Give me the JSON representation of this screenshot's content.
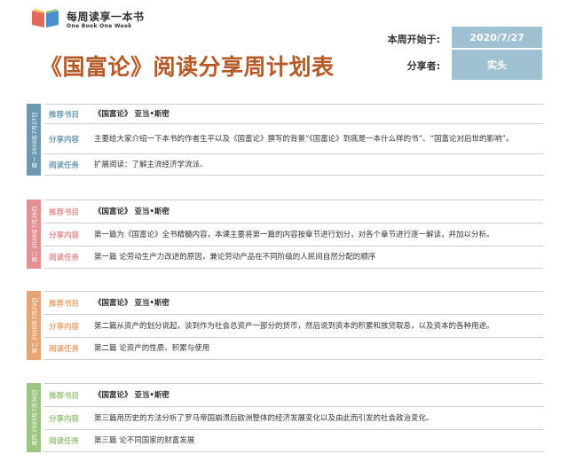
{
  "logo": {
    "cn": "每周读享一本书",
    "en": "One Book One Week"
  },
  "title": "《国富论》阅读分享周计划表",
  "header": {
    "start_label": "本周开始于:",
    "start_value": "2020/7/27",
    "sharer_label": "分享者:",
    "sharer_value": "实头"
  },
  "colors": {
    "blue": "#6b9ab0",
    "pink": "#e58f93",
    "orange": "#e8a472",
    "green": "#9cc57f"
  },
  "days": [
    {
      "tab": "周一 2020年7月27日",
      "color": "#6b9ab0",
      "rows": [
        {
          "label": "推荐书目",
          "text": "《国富论》 亚当•斯密"
        },
        {
          "label": "分享内容",
          "text": "主要给大家介绍一下本书的作者生平以及《国富论》撰写的背景”《国富论》到底是一本什么样的书”、“国富论对后世的影响”。"
        },
        {
          "label": "阅读任务",
          "text": "扩展阅读：了解主流经济学流派、"
        }
      ]
    },
    {
      "tab": "周二 2020年7月28日",
      "color": "#e58f93",
      "rows": [
        {
          "label": "推荐书目",
          "text": "《国富论》 亚当•斯密"
        },
        {
          "label": "分享内容",
          "text": "第一篇为《国富论》全书精髓内容，本课主要将第一篇的内容按章节进行划分，对各个章节进行逐一解读，并加以分析。"
        },
        {
          "label": "阅读任务",
          "text": "第一篇  论劳动生产力改进的原因，兼论劳动产品在不同阶级的人民间自然分配的顺序"
        }
      ]
    },
    {
      "tab": "周三 2020年7月29日",
      "color": "#e8a472",
      "rows": [
        {
          "label": "推荐书目",
          "text": "《国富论》 亚当•斯密"
        },
        {
          "label": "分享内容",
          "text": "第二篇从资产的划分说起，谈到作为社会总资产一部分的货币，然后说到资本的积累和放贷取息，以及资本的各种用途。"
        },
        {
          "label": "阅读任务",
          "text": "第二篇  论资产的性质、积累与使用"
        }
      ]
    },
    {
      "tab": "周四 2020年7月30日",
      "color": "#9cc57f",
      "rows": [
        {
          "label": "推荐书目",
          "text": "《国富论》 亚当•斯密"
        },
        {
          "label": "分享内容",
          "text": "第三篇用历史的方法分析了罗马帝国崩溃后欧洲整体的经济发展变化以及由此而引发的社会政治变化。"
        },
        {
          "label": "阅读任务",
          "text": "第三篇  论不同国家的财富发展"
        }
      ]
    }
  ]
}
